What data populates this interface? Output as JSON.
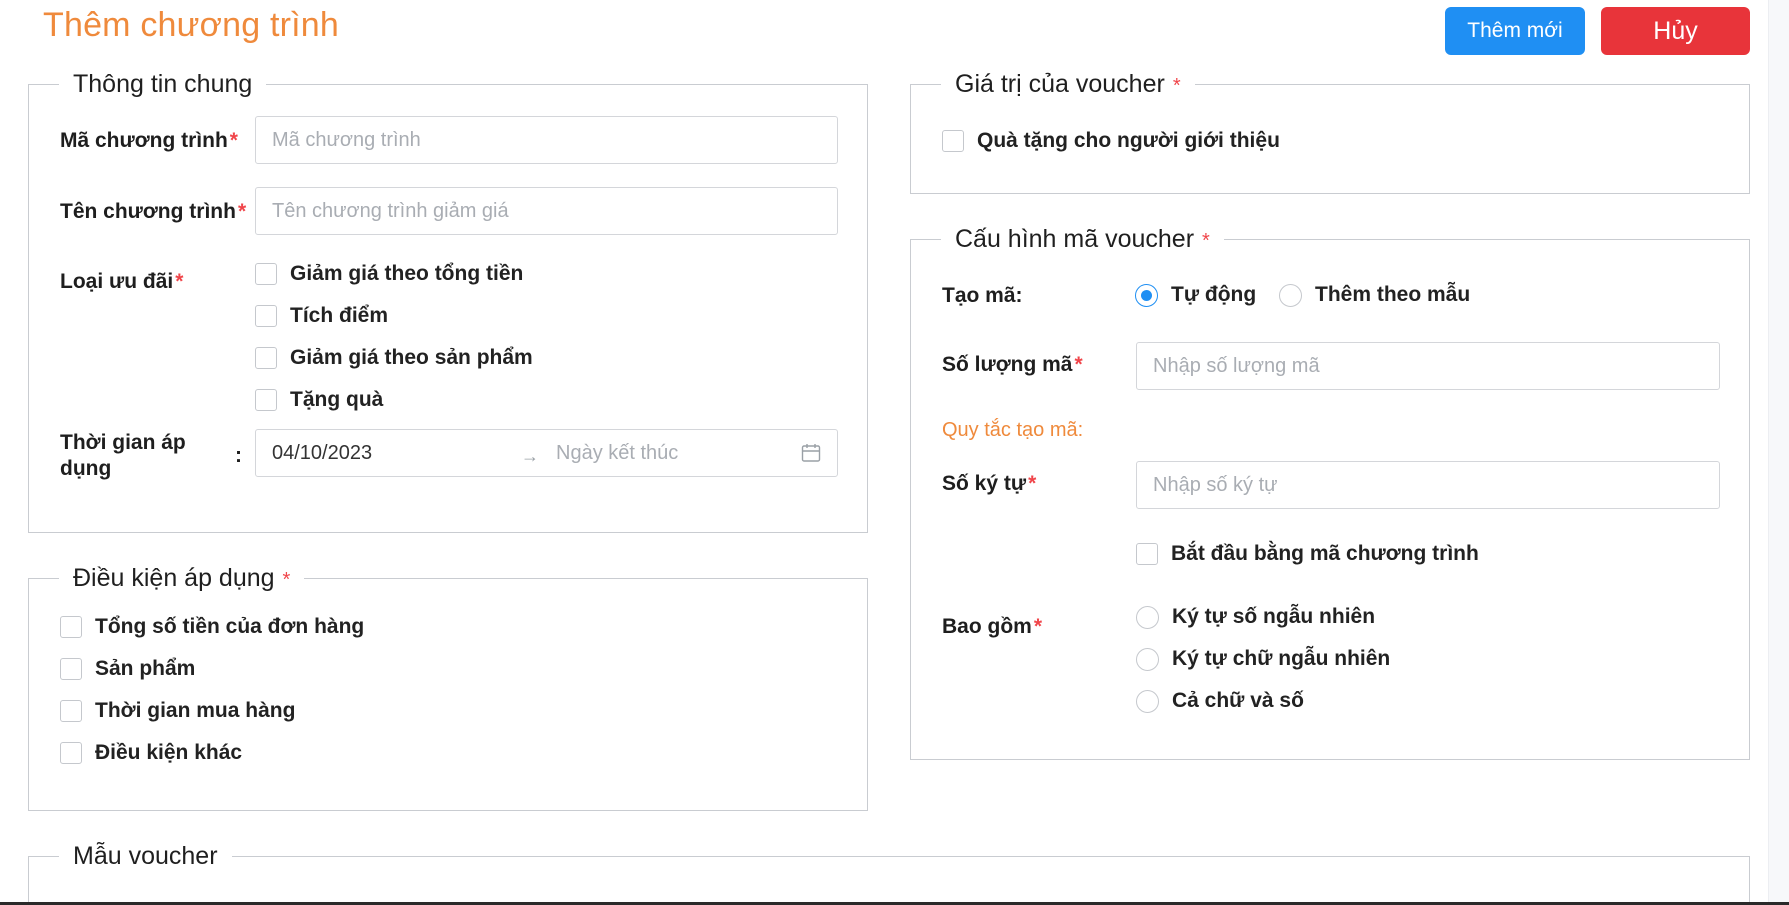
{
  "header": {
    "title": "Thêm chương trình",
    "add_button": "Thêm mới",
    "cancel_button": "Hủy"
  },
  "general_info": {
    "legend": "Thông tin chung",
    "program_code": {
      "label": "Mã chương trình",
      "placeholder": "Mã chương trình",
      "value": ""
    },
    "program_name": {
      "label": "Tên chương trình",
      "placeholder": "Tên chương trình giảm giá",
      "value": ""
    },
    "offer_type": {
      "label": "Loại ưu đãi",
      "options": [
        {
          "label": "Giảm giá theo tổng tiền",
          "checked": false
        },
        {
          "label": "Tích điểm",
          "checked": false
        },
        {
          "label": "Giảm giá theo sản phẩm",
          "checked": false
        },
        {
          "label": "Tặng quà",
          "checked": false
        }
      ]
    },
    "apply_time": {
      "label_line1": "Thời gian áp",
      "label_line2": "dụng",
      "colon": ":",
      "start_value": "04/10/2023",
      "end_placeholder": "Ngày kết thúc",
      "separator": "→"
    }
  },
  "conditions": {
    "legend": "Điều kiện áp dụng",
    "required_mark": "*",
    "options": [
      {
        "label": "Tổng số tiền của đơn hàng",
        "checked": false
      },
      {
        "label": "Sản phẩm",
        "checked": false
      },
      {
        "label": "Thời gian mua hàng",
        "checked": false
      },
      {
        "label": "Điều kiện khác",
        "checked": false
      }
    ]
  },
  "voucher_value": {
    "legend": "Giá trị của voucher",
    "required_mark": "*",
    "referrer_gift": {
      "label": "Quà tặng cho người giới thiệu",
      "checked": false
    }
  },
  "code_config": {
    "legend": "Cấu hình mã voucher",
    "required_mark": "*",
    "create_code": {
      "label": "Tạo mã:",
      "options": [
        {
          "label": "Tự động",
          "selected": true
        },
        {
          "label": "Thêm theo mẫu",
          "selected": false
        }
      ]
    },
    "code_count": {
      "label": "Số lượng mã",
      "placeholder": "Nhập số lượng mã",
      "value": ""
    },
    "rule_heading": "Quy tắc tạo mã:",
    "char_count": {
      "label": "Số ký tự",
      "placeholder": "Nhập số ký tự",
      "value": ""
    },
    "start_with_code": {
      "label": "Bắt đầu bằng mã chương trình",
      "checked": false
    },
    "includes": {
      "label": "Bao gồm",
      "options": [
        {
          "label": "Ký tự số ngẫu nhiên",
          "selected": false
        },
        {
          "label": "Ký tự chữ ngẫu nhiên",
          "selected": false
        },
        {
          "label": "Cả chữ và số",
          "selected": false
        }
      ]
    }
  },
  "voucher_template": {
    "legend": "Mẫu voucher"
  },
  "colors": {
    "accent_orange": "#ef8a3c",
    "primary_blue": "#1f8ff3",
    "danger_red": "#e8343a",
    "required_red": "#f0454a"
  }
}
